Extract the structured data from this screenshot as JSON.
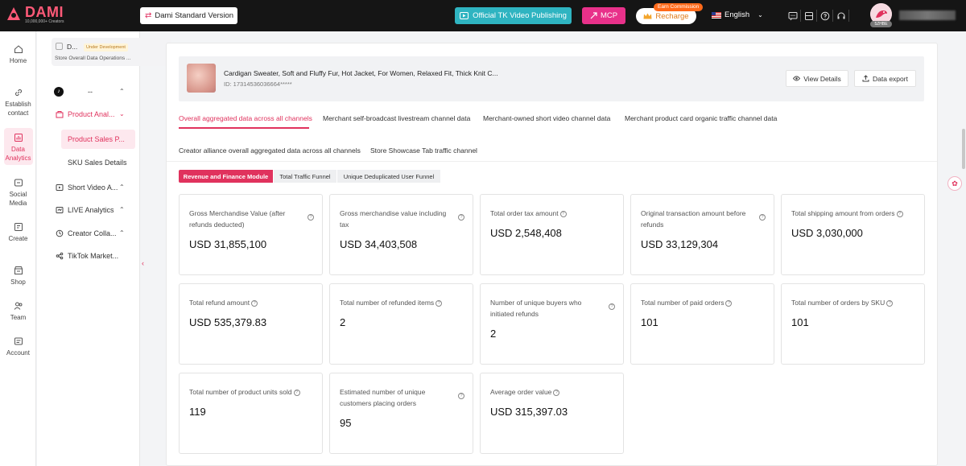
{
  "header": {
    "logo_name": "DAMI",
    "logo_sub": "10,000,000+ Creators",
    "version_label": "Dami Standard Version",
    "tk_publish_label": "Official TK Video Publishing",
    "mcp_label": "MCP",
    "recharge_label": "Recharge",
    "earn_badge": "Earn Commission",
    "language": "English",
    "avatar_tag": "5ZHBE"
  },
  "rail": {
    "items": [
      {
        "label": "Home",
        "icon": "home-icon"
      },
      {
        "label": "Establish contact",
        "icon": "link-icon"
      },
      {
        "label": "Data Analytics",
        "icon": "chart-icon"
      },
      {
        "label": "Social Media",
        "icon": "social-icon"
      },
      {
        "label": "Create",
        "icon": "create-icon"
      },
      {
        "label": "Shop",
        "icon": "shop-icon"
      },
      {
        "label": "Team",
        "icon": "team-icon"
      },
      {
        "label": "Account",
        "icon": "account-icon"
      }
    ]
  },
  "menu": {
    "store_short": "D...",
    "dev_badge": "Under Development",
    "store_sub": "Store Overall Data Operations ...",
    "account_label": "--",
    "product_analysis": "Product Anal...",
    "product_sales": "Product Sales P...",
    "sku_sales": "SKU Sales Details",
    "short_video": "Short Video A...",
    "live_analytics": "LIVE Analytics",
    "creator_collab": "Creator Colla...",
    "tiktok_market": "TikTok Market..."
  },
  "product": {
    "title": "Cardigan Sweater, Soft and Fluffy Fur, Hot Jacket, For Women, Relaxed Fit, Thick Knit C...",
    "id_label": "ID: ",
    "id_value": "17314536036664*****",
    "view_details": "View Details",
    "data_export": "Data export"
  },
  "tabs": [
    {
      "label": "Overall aggregated data across all channels",
      "active": true
    },
    {
      "label": "Merchant self-broadcast livestream channel data",
      "active": false
    },
    {
      "label": "Merchant-owned short video channel data",
      "active": false
    },
    {
      "label": "Merchant product card organic traffic channel data",
      "active": false
    },
    {
      "label": "Creator alliance overall aggregated data across all channels",
      "active": false
    },
    {
      "label": "Store Showcase Tab traffic channel",
      "active": false
    }
  ],
  "modules": [
    {
      "label": "Revenue and Finance Module",
      "active": true
    },
    {
      "label": "Total Traffic Funnel",
      "active": false
    },
    {
      "label": "Unique Deduplicated User Funnel",
      "active": false
    }
  ],
  "metrics": [
    {
      "label": "Gross Merchandise Value (after refunds deducted)",
      "value": "USD 31,855,100"
    },
    {
      "label": "Gross merchandise value including tax",
      "value": "USD 34,403,508"
    },
    {
      "label": "Total order tax amount",
      "value": "USD 2,548,408"
    },
    {
      "label": "Original transaction amount before refunds",
      "value": "USD 33,129,304"
    },
    {
      "label": "Total shipping amount from orders",
      "value": "USD 3,030,000"
    },
    {
      "label": "Total refund amount",
      "value": "USD 535,379.83"
    },
    {
      "label": "Total number of refunded items",
      "value": "2"
    },
    {
      "label": "Number of unique buyers who initiated refunds",
      "value": "2"
    },
    {
      "label": "Total number of paid orders",
      "value": "101"
    },
    {
      "label": "Total number of orders by SKU",
      "value": "101"
    },
    {
      "label": "Total number of product units sold",
      "value": "119"
    },
    {
      "label": "Estimated number of unique customers placing orders",
      "value": "95"
    },
    {
      "label": "Average order value",
      "value": "USD 315,397.03"
    }
  ],
  "colors": {
    "accent": "#e0325d",
    "topbar": "#151515",
    "tk_button": "#2fb4c1",
    "mcp_button": "#e8318a",
    "earn_badge": "#ff6a1a"
  }
}
